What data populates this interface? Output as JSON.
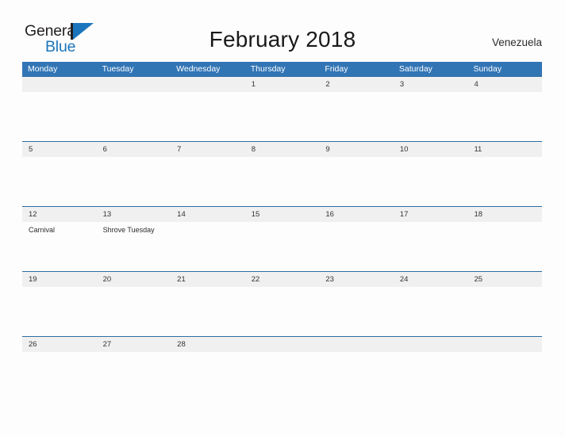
{
  "brand": {
    "name_part1": "General",
    "name_part2": "Blue"
  },
  "header": {
    "title": "February 2018",
    "region": "Venezuela"
  },
  "colors": {
    "header_blue": "#3275b5",
    "rule_blue": "#2e6da4",
    "date_band": "#f0f0f0",
    "brand_blue": "#1b75bc",
    "page_background": "#fdfdfd"
  },
  "calendar": {
    "day_headers": [
      "Monday",
      "Tuesday",
      "Wednesday",
      "Thursday",
      "Friday",
      "Saturday",
      "Sunday"
    ],
    "weeks": [
      {
        "days": [
          {
            "date": "",
            "events": []
          },
          {
            "date": "",
            "events": []
          },
          {
            "date": "",
            "events": []
          },
          {
            "date": "1",
            "events": []
          },
          {
            "date": "2",
            "events": []
          },
          {
            "date": "3",
            "events": []
          },
          {
            "date": "4",
            "events": []
          }
        ]
      },
      {
        "days": [
          {
            "date": "5",
            "events": []
          },
          {
            "date": "6",
            "events": []
          },
          {
            "date": "7",
            "events": []
          },
          {
            "date": "8",
            "events": []
          },
          {
            "date": "9",
            "events": []
          },
          {
            "date": "10",
            "events": []
          },
          {
            "date": "11",
            "events": []
          }
        ]
      },
      {
        "days": [
          {
            "date": "12",
            "events": [
              "Carnival"
            ]
          },
          {
            "date": "13",
            "events": [
              "Shrove Tuesday"
            ]
          },
          {
            "date": "14",
            "events": []
          },
          {
            "date": "15",
            "events": []
          },
          {
            "date": "16",
            "events": []
          },
          {
            "date": "17",
            "events": []
          },
          {
            "date": "18",
            "events": []
          }
        ]
      },
      {
        "days": [
          {
            "date": "19",
            "events": []
          },
          {
            "date": "20",
            "events": []
          },
          {
            "date": "21",
            "events": []
          },
          {
            "date": "22",
            "events": []
          },
          {
            "date": "23",
            "events": []
          },
          {
            "date": "24",
            "events": []
          },
          {
            "date": "25",
            "events": []
          }
        ]
      },
      {
        "days": [
          {
            "date": "26",
            "events": []
          },
          {
            "date": "27",
            "events": []
          },
          {
            "date": "28",
            "events": []
          },
          {
            "date": "",
            "events": []
          },
          {
            "date": "",
            "events": []
          },
          {
            "date": "",
            "events": []
          },
          {
            "date": "",
            "events": []
          }
        ]
      }
    ]
  }
}
